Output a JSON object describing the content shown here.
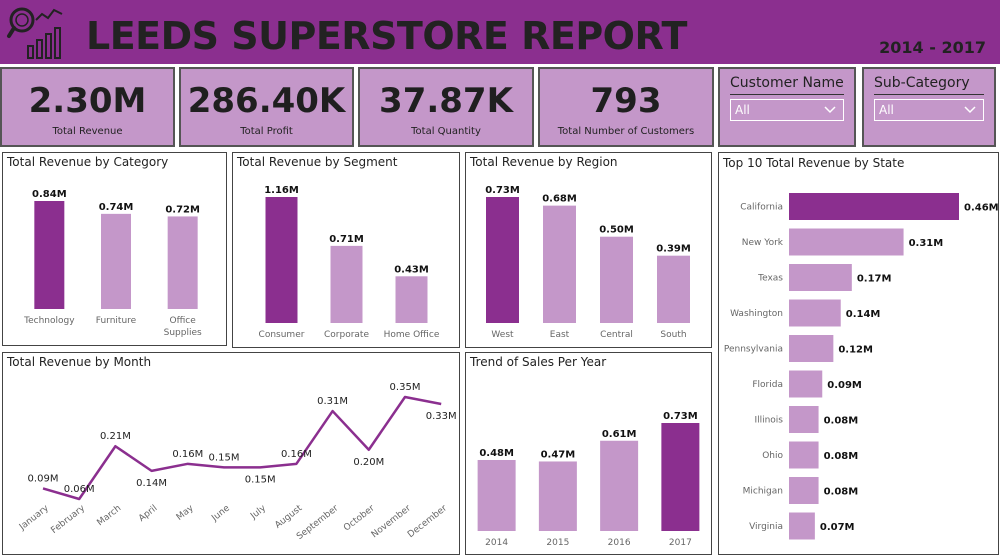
{
  "header": {
    "title": "LEEDS SUPERSTORE REPORT",
    "years": "2014 - 2017",
    "bg_color": "#8b2f8f"
  },
  "colors": {
    "accent": "#8b2f8f",
    "bar_light": "#c497c9",
    "kpi_bg": "#c497c9"
  },
  "kpis": [
    {
      "value": "2.30M",
      "label": "Total Revenue"
    },
    {
      "value": "286.40K",
      "label": "Total Profit"
    },
    {
      "value": "37.87K",
      "label": "Total Quantity"
    },
    {
      "value": "793",
      "label": "Total Number of Customers"
    }
  ],
  "slicers": [
    {
      "title": "Customer Name",
      "value": "All"
    },
    {
      "title": "Sub-Category",
      "value": "All"
    }
  ],
  "chart_data": [
    {
      "id": "category",
      "type": "bar",
      "title": "Total Revenue by Category",
      "categories": [
        "Technology",
        "Furniture",
        "Office Supplies"
      ],
      "values": [
        0.84,
        0.74,
        0.72
      ],
      "labels": [
        "0.84M",
        "0.74M",
        "0.72M"
      ],
      "highlight": [
        true,
        false,
        false
      ],
      "ylim": [
        0,
        0.84
      ]
    },
    {
      "id": "segment",
      "type": "bar",
      "title": "Total Revenue by Segment",
      "categories": [
        "Consumer",
        "Corporate",
        "Home Office"
      ],
      "values": [
        1.16,
        0.71,
        0.43
      ],
      "labels": [
        "1.16M",
        "0.71M",
        "0.43M"
      ],
      "highlight": [
        true,
        false,
        false
      ],
      "ylim": [
        0,
        1.16
      ]
    },
    {
      "id": "region",
      "type": "bar",
      "title": "Total Revenue by Region",
      "categories": [
        "West",
        "East",
        "Central",
        "South"
      ],
      "values": [
        0.73,
        0.68,
        0.5,
        0.39
      ],
      "labels": [
        "0.73M",
        "0.68M",
        "0.50M",
        "0.39M"
      ],
      "highlight": [
        true,
        false,
        false,
        false
      ],
      "ylim": [
        0,
        0.73
      ]
    },
    {
      "id": "state",
      "type": "bar",
      "orientation": "horizontal",
      "title": "Top 10 Total Revenue by State",
      "categories": [
        "California",
        "New York",
        "Texas",
        "Washington",
        "Pennsylvania",
        "Florida",
        "Illinois",
        "Ohio",
        "Michigan",
        "Virginia"
      ],
      "values": [
        0.46,
        0.31,
        0.17,
        0.14,
        0.12,
        0.09,
        0.08,
        0.08,
        0.08,
        0.07
      ],
      "labels": [
        "0.46M",
        "0.31M",
        "0.17M",
        "0.14M",
        "0.12M",
        "0.09M",
        "0.08M",
        "0.08M",
        "0.08M",
        "0.07M"
      ],
      "highlight": [
        true,
        false,
        false,
        false,
        false,
        false,
        false,
        false,
        false,
        false
      ],
      "xlim": [
        0,
        0.46
      ]
    },
    {
      "id": "month",
      "type": "line",
      "title": "Total Revenue by Month",
      "categories": [
        "January",
        "February",
        "March",
        "April",
        "May",
        "June",
        "July",
        "August",
        "September",
        "October",
        "November",
        "December"
      ],
      "values": [
        0.09,
        0.06,
        0.21,
        0.14,
        0.16,
        0.15,
        0.15,
        0.16,
        0.31,
        0.2,
        0.35,
        0.33
      ],
      "labels": [
        "0.09M",
        "0.06M",
        "0.21M",
        "0.14M",
        "0.16M",
        "0.15M",
        "0.15M",
        "0.16M",
        "0.31M",
        "0.20M",
        "0.35M",
        "0.33M"
      ],
      "label_pos": [
        "above",
        "above",
        "above",
        "below",
        "above",
        "above",
        "below",
        "above",
        "above",
        "below",
        "above",
        "below"
      ],
      "ylim": [
        0.06,
        0.35
      ]
    },
    {
      "id": "year",
      "type": "bar",
      "title": "Trend of Sales Per Year",
      "categories": [
        "2014",
        "2015",
        "2016",
        "2017"
      ],
      "values": [
        0.48,
        0.47,
        0.61,
        0.73
      ],
      "labels": [
        "0.48M",
        "0.47M",
        "0.61M",
        "0.73M"
      ],
      "highlight": [
        false,
        false,
        false,
        true
      ],
      "ylim": [
        0,
        0.73
      ]
    }
  ]
}
